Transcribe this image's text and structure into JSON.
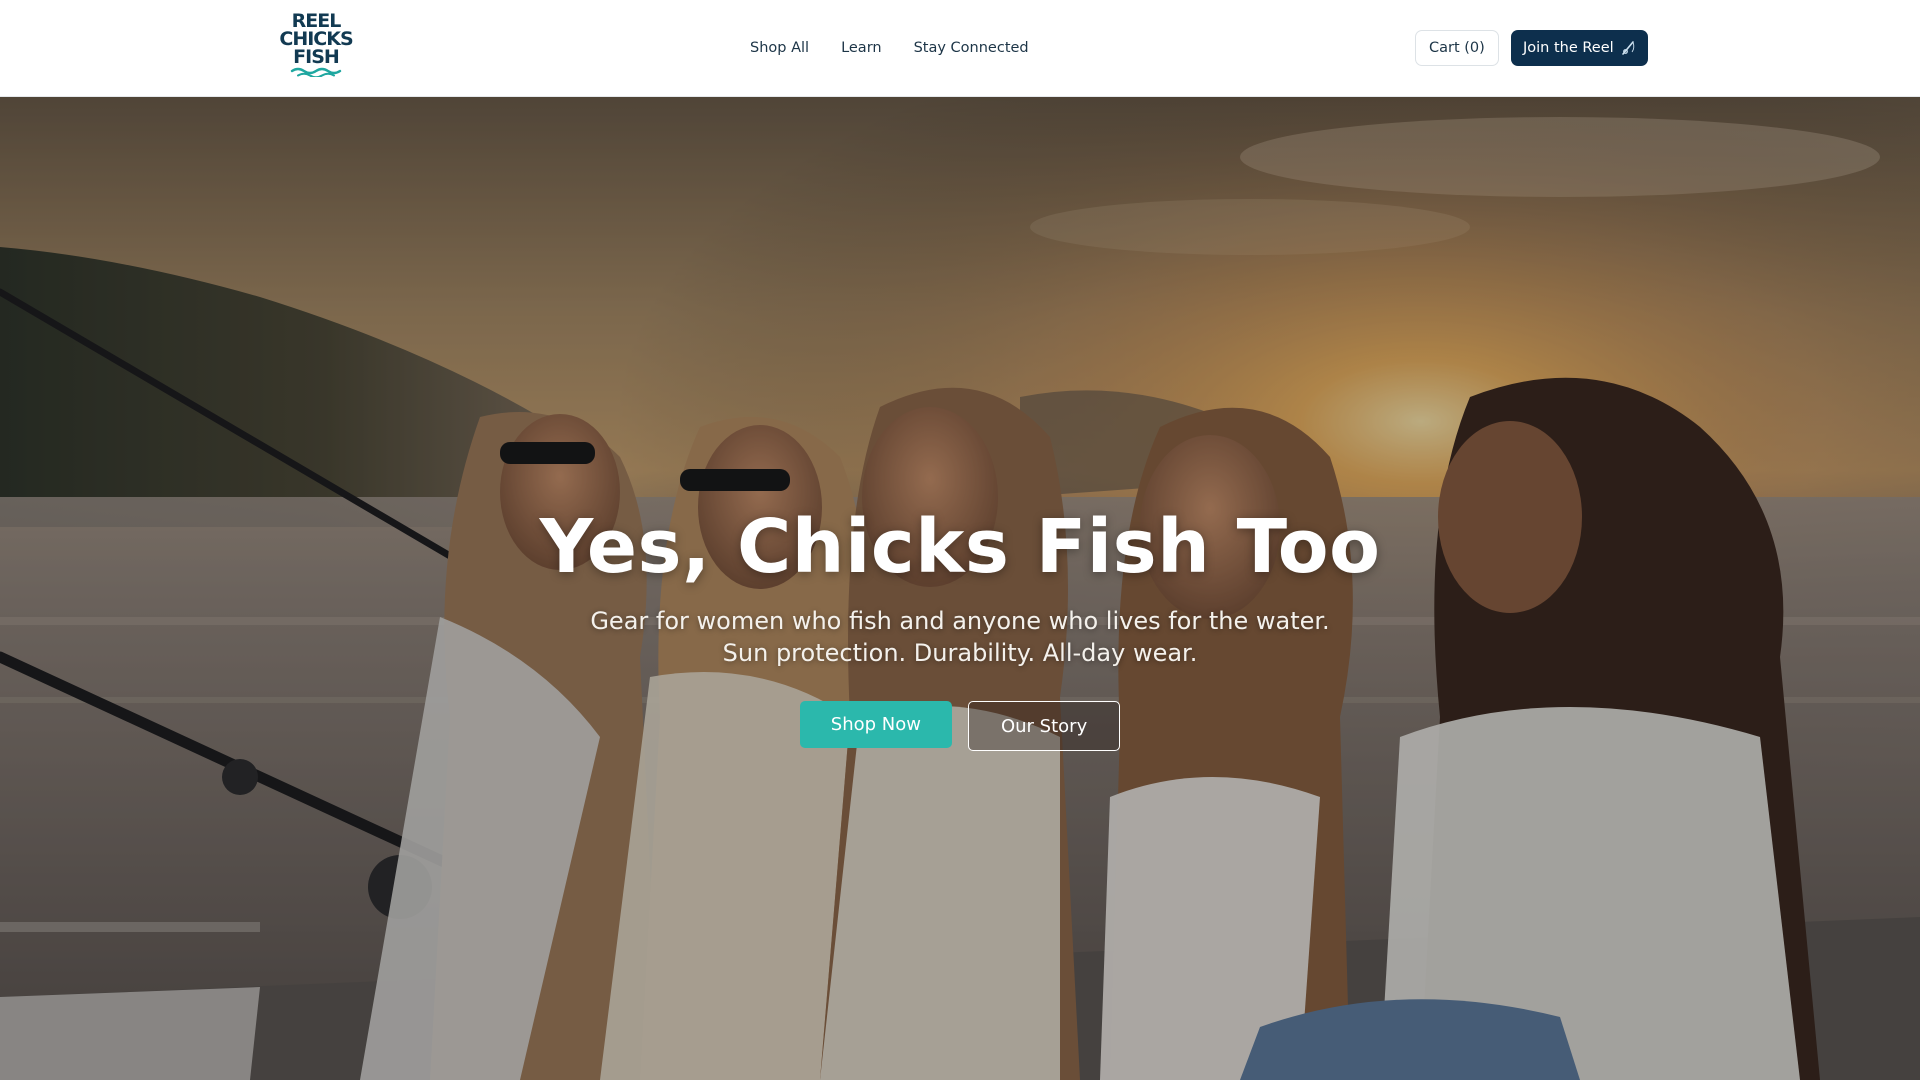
{
  "brand": {
    "logo_text": [
      "REEL",
      "CHICKS",
      "FISH"
    ],
    "logo_icon": "fish-hook-waves-logo",
    "colors": {
      "navy": "#0d2f4d",
      "teal": "#2bb8ac",
      "logo_navy": "#123a52",
      "logo_teal": "#1fa7a0"
    }
  },
  "nav": {
    "items": [
      {
        "label": "Shop All"
      },
      {
        "label": "Learn"
      },
      {
        "label": "Stay Connected"
      }
    ]
  },
  "header_actions": {
    "cart_label": "Cart (0)",
    "join_label": "Join the Reel",
    "join_icon": "fishing-rod-icon"
  },
  "hero": {
    "title": "Yes, Chicks Fish Too",
    "subtitle_lines": [
      "Gear for women who fish and anyone who lives for the water.",
      "Sun protection. Durability. All-day wear."
    ],
    "primary_cta": "Shop Now",
    "secondary_cta": "Our Story",
    "image_subject": "five women laughing while fishing from a boat at sunset"
  }
}
